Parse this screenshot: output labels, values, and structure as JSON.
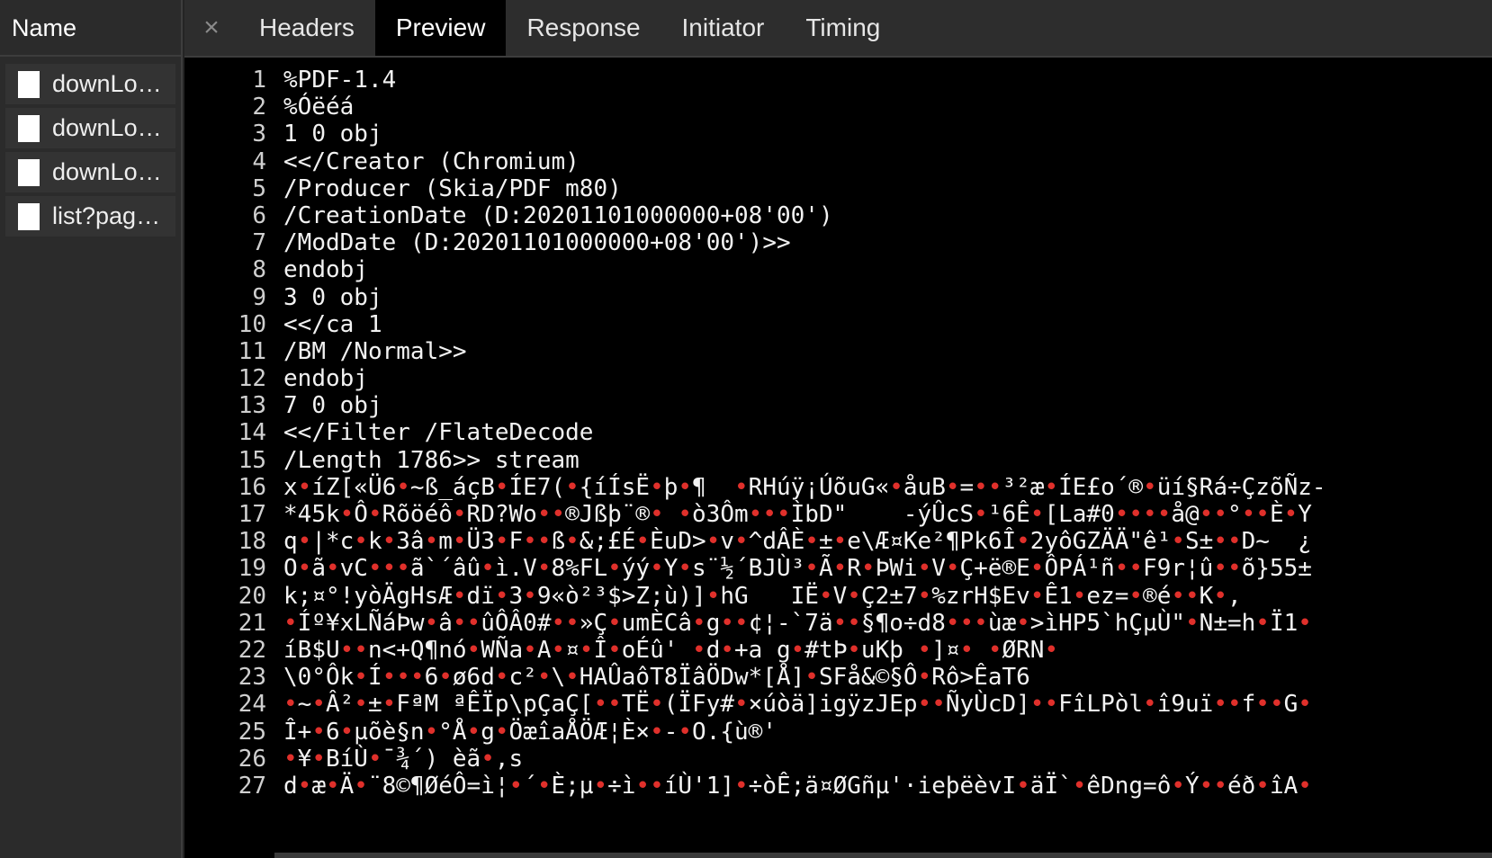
{
  "left_panel": {
    "header": "Name",
    "requests": [
      {
        "label": "downLo…"
      },
      {
        "label": "downLo…"
      },
      {
        "label": "downLo…"
      },
      {
        "label": "list?pag…"
      }
    ]
  },
  "tabs": [
    {
      "label": "Headers",
      "active": false
    },
    {
      "label": "Preview",
      "active": true
    },
    {
      "label": "Response",
      "active": false
    },
    {
      "label": "Initiator",
      "active": false
    },
    {
      "label": "Timing",
      "active": false
    }
  ],
  "close_symbol": "×",
  "code_lines": [
    "%PDF-1.4",
    "%Óëéá",
    "1 0 obj",
    "<</Creator (Chromium)",
    "/Producer (Skia/PDF m80)",
    "/CreationDate (D:20201101000000+08'00')",
    "/ModDate (D:20201101000000+08'00')>>",
    "endobj",
    "3 0 obj",
    "<</ca 1",
    "/BM /Normal>>",
    "endobj",
    "7 0 obj",
    "<</Filter /FlateDecode",
    "/Length 1786>> stream",
    "x•íZ[«Ü6•~ß_áçB•ÍE7(•{íÍsË•þ•¶  •RHúÿ¡ÚõuG«•åuB•=••³²æ•ÍE£o´®•üí§Rá÷ÇzõÑz-",
    "*45k•Ô•Rõöéô•RD?Wo••®Jßþ¨®• •ò3Ôm•••ÌbD\"    -ýÛcS•¹6Ê•[La#0••••å@••°••È•Y",
    "q•|*c•k•3â•m•Ü3•F••ß•&;£É•ÈuD>•v•^dÂÈ•±•e\\Æ¤Ke²¶Pk6Î•2yôGZÄÄ\"ê¹•S±••D~  ¿",
    "O•ã•vC•••ã`´âû•ì.V•8%FL•ýý•Y•s¨½´BJÙ³•Ã•R•ÞWi•V•Ç+ë®E•ÔPÁ¹ñ••F9r¦û••õ}55±",
    "k;¤°!yòÄgHsÆ•dï•3•9«ò²³$>Z;ù)]•hG   IË•V•Ç2±7•%zrH$Ev•Ê1•ez=•®é••K•,",
    "•Íº¥xLÑáÞw•â••ûÔÂ0#••»Ç•umÈCâ•g••¢¦-`7ä••§¶o÷d8•••ùæ•>ìHP5`hÇµÙ\"•N±=h•Ï1•",
    "íB$U••n<+Q¶nó•WÑa•A•¤•Î•oÉû' •d•+a g•#tÞ•uKþ •]¤• •ØRN•",
    "\\0°Ôk•Í•••6•ø6d•c²•\\•HAÛaôT8ÏâÖDw*[Å]•SFå&©§Ô•Rô>ÊaT6",
    "•~•Â²•±•FªM ªÊÏp\\pÇaÇ[••TË•(ÏFy#•×úòä]igÿzJEp••ÑyÙcD]••FîLPòl•î9uï••f••G•",
    "Î+•6•µõè§n•°Å•g•ÖæîaÅÖÆ¦È×•-•O.{ù®'",
    "•¥•BíÙ•¯¾´) èã•,s",
    "d•æ•Ä•¨8©¶ØéÔ=ì¦•´•È;µ•÷ì••íÙ'1]•÷òÊ;ä¤ØGñµ'·ieþëèvI•äÏ`•êDng=ô•Ý••éð•îA•"
  ],
  "colors": {
    "background": "#242424",
    "editor_bg": "#000000",
    "active_tab_bg": "#000000",
    "invalid_char_marker": "#e0302b"
  },
  "icons": {
    "close": "close-icon",
    "request_file": "file-icon"
  }
}
